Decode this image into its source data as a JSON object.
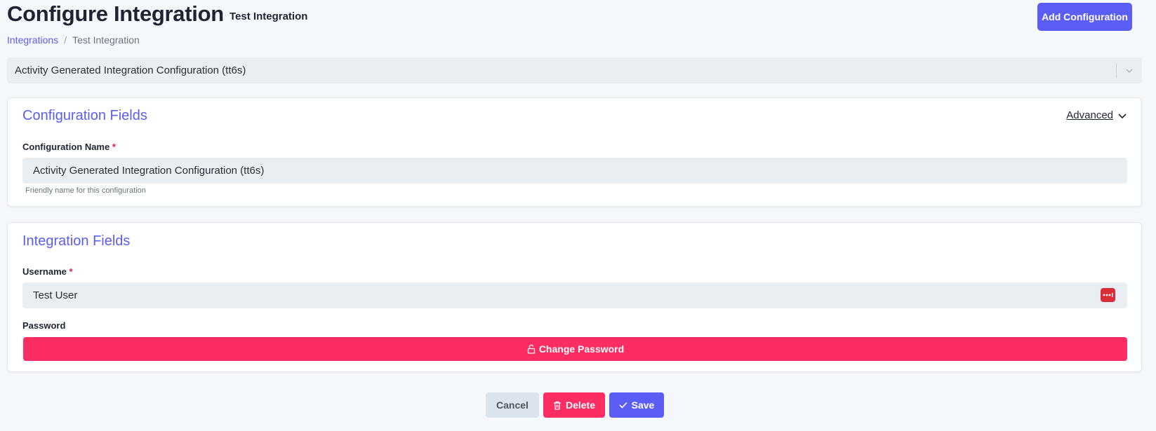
{
  "header": {
    "title": "Configure Integration",
    "subtitle": "Test Integration",
    "add_button": "Add Configuration"
  },
  "breadcrumb": {
    "items": [
      {
        "label": "Integrations"
      },
      {
        "label": "Test Integration"
      }
    ],
    "separator": "/"
  },
  "config_select": {
    "selected": "Activity Generated Integration Configuration (tt6s)"
  },
  "configuration_fields": {
    "title": "Configuration Fields",
    "advanced_label": "Advanced",
    "name_label": "Configuration Name",
    "required_marker": "*",
    "name_value": "Activity Generated Integration Configuration (tt6s)",
    "name_helper": "Friendly name for this configuration"
  },
  "integration_fields": {
    "title": "Integration Fields",
    "username_label": "Username",
    "required_marker": "*",
    "username_value": "Test User",
    "password_label": "Password",
    "change_password": "Change Password"
  },
  "actions": {
    "cancel": "Cancel",
    "delete": "Delete",
    "save": "Save"
  },
  "colors": {
    "primary": "#5b5ef4",
    "danger": "#fb2d63",
    "background": "#f5f8fb",
    "input_bg": "#e9eef3"
  }
}
